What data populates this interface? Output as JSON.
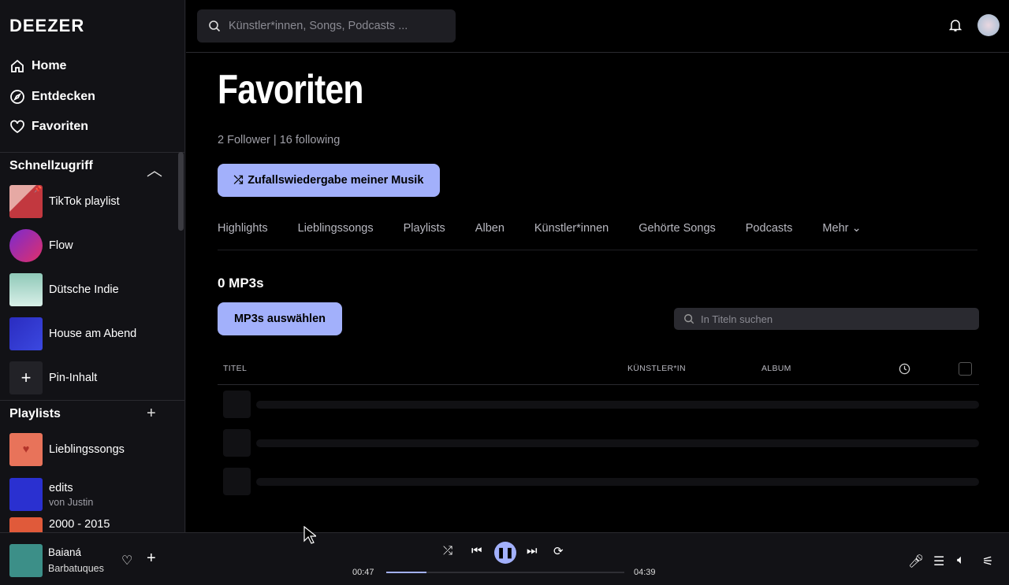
{
  "sidebar": {
    "logo": "DEEZER",
    "nav": [
      {
        "label": "Home",
        "icon": "home-icon"
      },
      {
        "label": "Entdecken",
        "icon": "compass-icon"
      },
      {
        "label": "Favoriten",
        "icon": "heart-icon"
      }
    ],
    "quick_access": {
      "title": "Schnellzugriff",
      "items": [
        {
          "label": "TikTok playlist",
          "cover_text": "TikTok playlist",
          "color": "#c2383f"
        },
        {
          "label": "Flow",
          "cover_text": "Flow",
          "color": "#b0309a"
        },
        {
          "label": "Dütsche Indie",
          "cover_text": "Dütsche Indie",
          "color": "#9fd3c4"
        },
        {
          "label": "House am Abend",
          "cover_text": "House am Abend",
          "color": "#2a2cc0"
        },
        {
          "label": "Pin-Inhalt"
        }
      ]
    },
    "playlists": {
      "title": "Playlists",
      "items": [
        {
          "label": "Lieblingssongs",
          "color": "#e8735a"
        },
        {
          "label": "edits",
          "sub": "von Justin",
          "cover_text": "edits",
          "color": "#2a30d0"
        },
        {
          "label": "2000 - 2015",
          "color": "#e05a3a"
        }
      ]
    }
  },
  "header": {
    "search_placeholder": "Künstler*innen, Songs, Podcasts ..."
  },
  "main": {
    "title": "Favoriten",
    "follow": "2 Follower | 16 following",
    "shuffle_label": "Zufallswiedergabe meiner Musik",
    "tabs": [
      "Highlights",
      "Lieblingssongs",
      "Playlists",
      "Alben",
      "Künstler*innen",
      "Gehörte Songs",
      "Podcasts",
      "Mehr"
    ],
    "count": "0 MP3s",
    "select_label": "MP3s auswählen",
    "filter_placeholder": "In Titeln suchen",
    "columns": [
      "TITEL",
      "KÜNSTLER*IN",
      "ALBUM"
    ]
  },
  "player": {
    "title": "Baianá",
    "artist": "Barbatuques",
    "elapsed": "00:47",
    "duration": "04:39",
    "progress": 0.17,
    "state": "playing"
  },
  "colors": {
    "accent": "#a2b0fb"
  }
}
